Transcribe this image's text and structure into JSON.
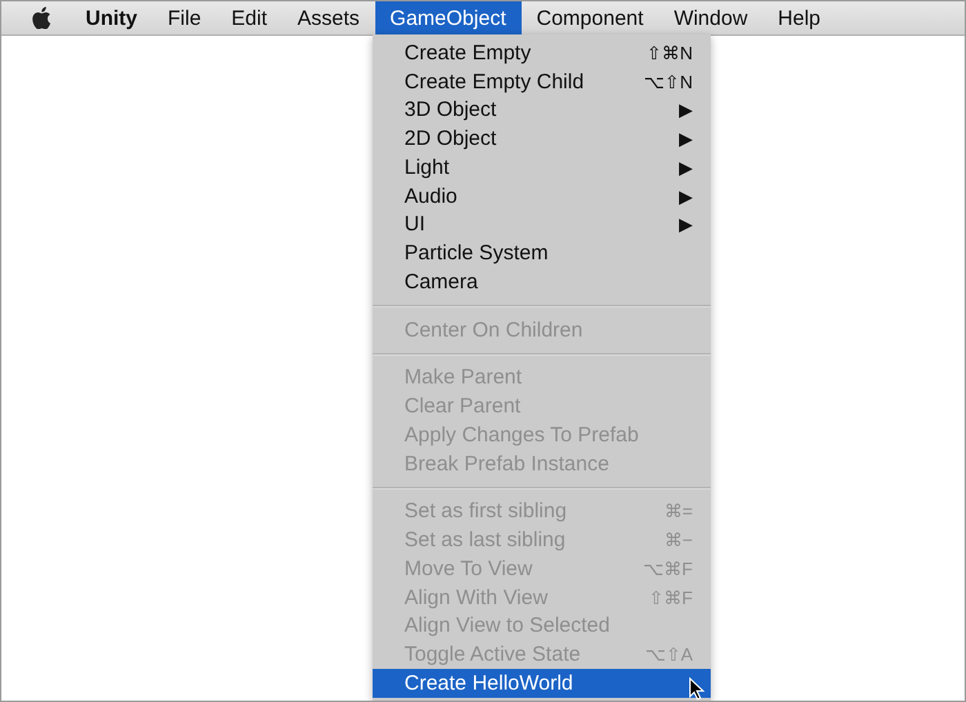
{
  "menu_bar": {
    "app": "Unity",
    "menus": [
      {
        "label": "File",
        "selected": false
      },
      {
        "label": "Edit",
        "selected": false
      },
      {
        "label": "Assets",
        "selected": false
      },
      {
        "label": "GameObject",
        "selected": true
      },
      {
        "label": "Component",
        "selected": false
      },
      {
        "label": "Window",
        "selected": false
      },
      {
        "label": "Help",
        "selected": false
      }
    ]
  },
  "dropdown": {
    "sections": [
      {
        "items": [
          {
            "label": "Create Empty",
            "shortcut": "⇧⌘N",
            "disabled": false,
            "selected": false
          },
          {
            "label": "Create Empty Child",
            "shortcut": "⌥⇧N",
            "disabled": false,
            "selected": false
          },
          {
            "label": "3D Object",
            "shortcut": "▶",
            "disabled": false,
            "selected": false
          },
          {
            "label": "2D Object",
            "shortcut": "▶",
            "disabled": false,
            "selected": false
          },
          {
            "label": "Light",
            "shortcut": "▶",
            "disabled": false,
            "selected": false
          },
          {
            "label": "Audio",
            "shortcut": "▶",
            "disabled": false,
            "selected": false
          },
          {
            "label": "UI",
            "shortcut": "▶",
            "disabled": false,
            "selected": false
          },
          {
            "label": "Particle System",
            "disabled": false,
            "selected": false
          },
          {
            "label": "Camera",
            "disabled": false,
            "selected": false
          }
        ]
      },
      {
        "items": [
          {
            "label": "Center On Children",
            "disabled": true,
            "selected": false
          }
        ]
      },
      {
        "items": [
          {
            "label": "Make Parent",
            "disabled": true,
            "selected": false
          },
          {
            "label": "Clear Parent",
            "disabled": true,
            "selected": false
          },
          {
            "label": "Apply Changes To Prefab",
            "disabled": true,
            "selected": false
          },
          {
            "label": "Break Prefab Instance",
            "disabled": true,
            "selected": false
          }
        ]
      },
      {
        "items": [
          {
            "label": "Set as first sibling",
            "shortcut": "⌘=",
            "disabled": true,
            "selected": false
          },
          {
            "label": "Set as last sibling",
            "shortcut": "⌘−",
            "disabled": true,
            "selected": false
          },
          {
            "label": "Move To View",
            "shortcut": "⌥⌘F",
            "disabled": true,
            "selected": false
          },
          {
            "label": "Align With View",
            "shortcut": "⇧⌘F",
            "disabled": true,
            "selected": false
          },
          {
            "label": "Align View to Selected",
            "disabled": true,
            "selected": false
          },
          {
            "label": "Toggle Active State",
            "shortcut": "⌥⇧A",
            "disabled": true,
            "selected": false
          },
          {
            "label": "Create HelloWorld",
            "disabled": false,
            "selected": true
          }
        ]
      }
    ]
  }
}
